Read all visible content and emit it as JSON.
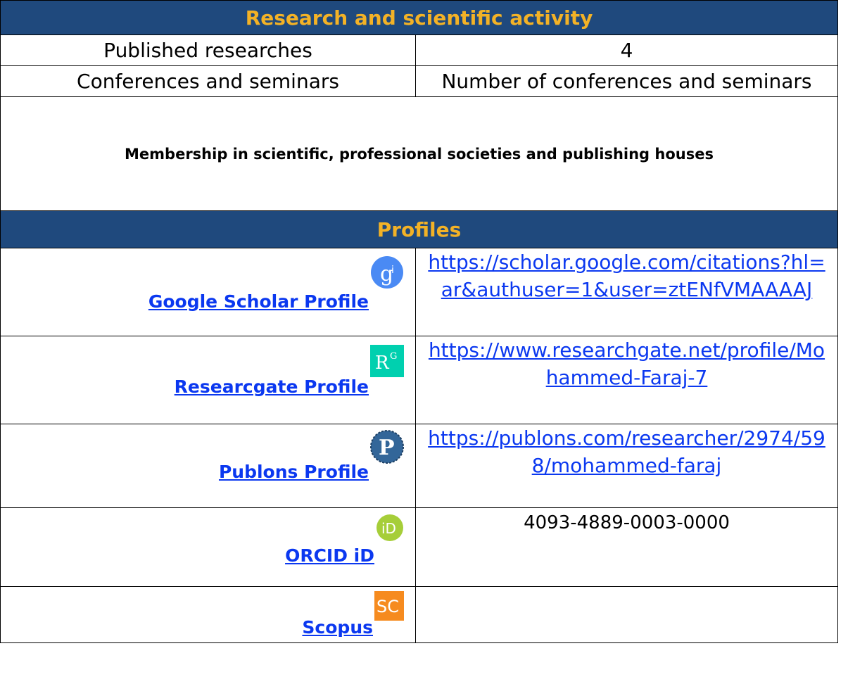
{
  "research": {
    "header": "Research and scientific activity",
    "rows": [
      {
        "label": "Published researches",
        "value": "4"
      },
      {
        "label": "Conferences and seminars",
        "value": "Number of conferences and seminars"
      }
    ],
    "membership": "Membership in scientific, professional societies and publishing houses"
  },
  "profiles": {
    "header": "Profiles",
    "items": [
      {
        "label": "Google Scholar Profile",
        "icon": "google-scholar-icon",
        "value": "https://scholar.google.com/citations?hl=ar&authuser=1&user=ztENfVMAAAAJ"
      },
      {
        "label": "Researcgate Profile",
        "icon": "researchgate-icon",
        "value": "https://www.researchgate.net/profile/Mohammed-Faraj-7"
      },
      {
        "label": "Publons Profile",
        "icon": "publons-icon",
        "value": "https://publons.com/researcher/2974/598/mohammed-faraj"
      },
      {
        "label": "ORCID iD",
        "icon": "orcid-icon",
        "value": "4093-4889-0003-0000"
      },
      {
        "label": "Scopus",
        "icon": "scopus-icon",
        "value": ""
      }
    ]
  },
  "colors": {
    "header_bg": "#1f497d",
    "header_text": "#f3b226",
    "link": "#0b38f0"
  }
}
